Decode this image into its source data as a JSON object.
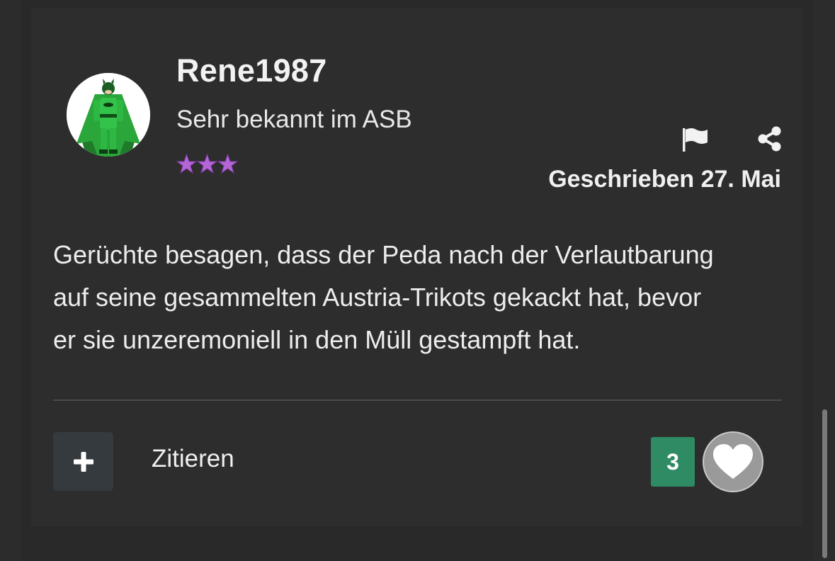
{
  "author": {
    "username": "Rene1987",
    "rank": "Sehr bekannt im ASB",
    "rank_stars": 3,
    "avatar_icon": "green-batman-avatar"
  },
  "actions": {
    "report_icon": "flag-icon",
    "share_icon": "share-icon"
  },
  "post": {
    "date": "Geschrieben 27. Mai",
    "body_lines": [
      "Gerüchte besagen, dass der Peda nach der Verlautbarung",
      "auf seine gesammelten Austria-Trikots gekackt hat, bevor",
      "er sie unzeremoniell in den Müll gestampft hat."
    ]
  },
  "footer": {
    "multiquote_icon": "plus-icon",
    "quote_label": "Zitieren",
    "like_count": "3",
    "like_icon": "heart-icon"
  },
  "colors": {
    "background": "#2a2a2a",
    "card": "#2d2d2d",
    "star": "#b466d6",
    "like_count_bg": "#2f8b64",
    "like_button_bg": "#9a9a9a"
  }
}
